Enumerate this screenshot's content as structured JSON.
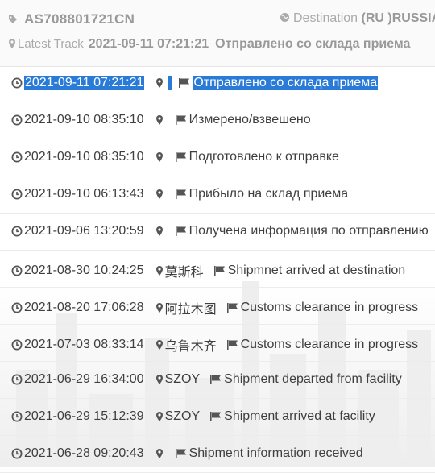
{
  "header": {
    "tracking_number": "AS708801721CN",
    "destination_label": "Destination",
    "destination_value": "(RU )RUSSIA",
    "latest_track_label": "Latest Track",
    "latest_track_time": "2021-09-11 07:21:21",
    "latest_track_status": "Отправлено со склада приема"
  },
  "events": [
    {
      "time": "2021-09-11 07:21:21",
      "location": "",
      "status": "Отправлено со склада приема"
    },
    {
      "time": "2021-09-10 08:35:10",
      "location": "",
      "status": "Измерено/взвешено"
    },
    {
      "time": "2021-09-10 08:35:10",
      "location": "",
      "status": "Подготовлено к отправке"
    },
    {
      "time": "2021-09-10 06:13:43",
      "location": "",
      "status": "Прибыло на склад приема"
    },
    {
      "time": "2021-09-06 13:20:59",
      "location": "",
      "status": "Получена информация по отправлению"
    },
    {
      "time": "2021-08-30 10:24:25",
      "location": "莫斯科",
      "status": "Shipmnet arrived at destination"
    },
    {
      "time": "2021-08-20 17:06:28",
      "location": "阿拉木图",
      "status": "Customs clearance in progress"
    },
    {
      "time": "2021-07-03 08:33:14",
      "location": "乌鲁木齐",
      "status": "Customs clearance in progress"
    },
    {
      "time": "2021-06-29 16:34:00",
      "location": "SZOY",
      "status": "Shipment departed from facility"
    },
    {
      "time": "2021-06-29 15:12:39",
      "location": "SZOY",
      "status": "Shipment arrived at facility"
    },
    {
      "time": "2021-06-28 09:20:43",
      "location": "",
      "status": "Shipment information received"
    }
  ],
  "colors": {
    "selection": "#2a7bd8",
    "icon": "#555555",
    "muted": "#999999"
  },
  "icons": {
    "tracking": "tag-icon",
    "destination": "globe-icon",
    "latest": "map-pin-icon",
    "time": "clock-icon",
    "location": "map-pin-icon",
    "status": "flag-icon"
  }
}
